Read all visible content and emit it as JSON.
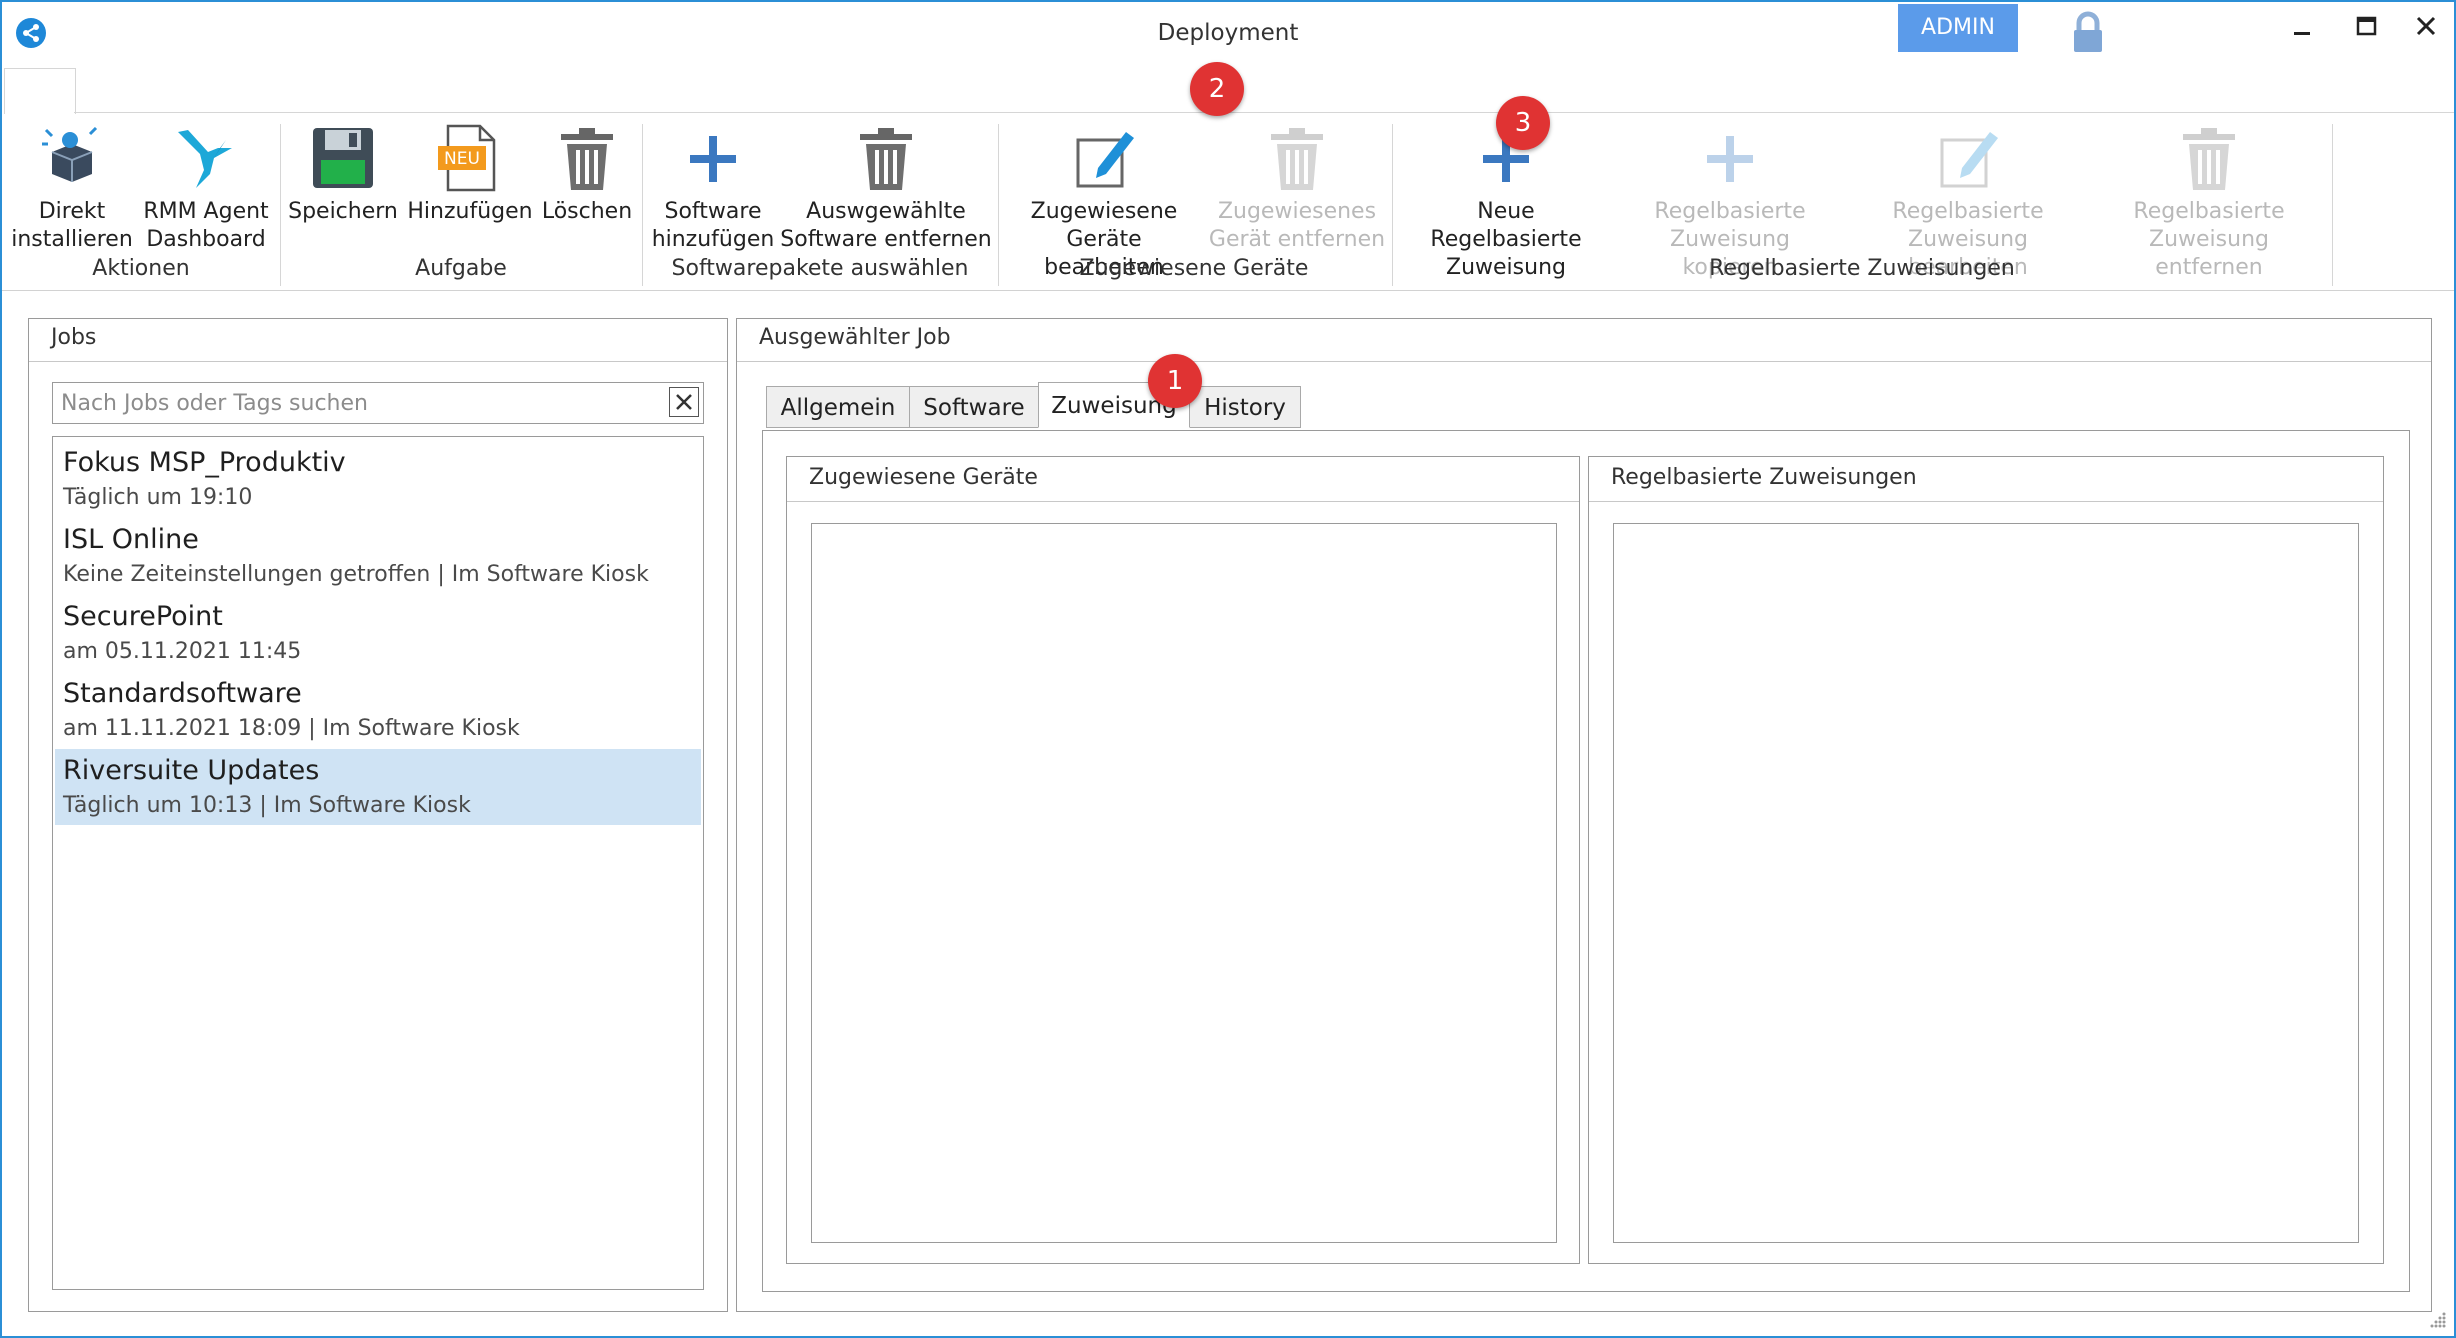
{
  "window": {
    "title": "Deployment",
    "user_badge": "ADMIN",
    "accent": "#2b8fd6",
    "badge_color": "#5b9bea"
  },
  "icons": [
    "share-icon",
    "lock-icon",
    "minimize-icon",
    "maximize-icon",
    "close-icon"
  ],
  "ribbon": {
    "groups": [
      {
        "label": "Aktionen",
        "buttons": [
          {
            "label": "Direkt installieren",
            "lines": [
              "Direkt",
              "installieren"
            ],
            "icon": "install-box-icon",
            "enabled": true
          },
          {
            "label": "RMM Agent Dashboard",
            "lines": [
              "RMM Agent",
              "Dashboard"
            ],
            "icon": "hummingbird-icon",
            "enabled": true
          }
        ]
      },
      {
        "label": "Aufgabe",
        "buttons": [
          {
            "label": "Speichern",
            "lines": [
              "Speichern"
            ],
            "icon": "floppy-disk-icon",
            "enabled": true
          },
          {
            "label": "Hinzufügen",
            "lines": [
              "Hinzufügen"
            ],
            "icon": "new-document-icon",
            "icon_text": "NEU",
            "enabled": true
          },
          {
            "label": "Löschen",
            "lines": [
              "Löschen"
            ],
            "icon": "trash-icon",
            "enabled": true
          }
        ]
      },
      {
        "label": "Softwarepakete auswählen",
        "buttons": [
          {
            "label": "Software hinzufügen",
            "lines": [
              "Software",
              "hinzufügen"
            ],
            "icon": "plus-icon",
            "enabled": true
          },
          {
            "label": "Auswgewählte Software entfernen",
            "lines": [
              "Auswgewählte",
              "Software entfernen"
            ],
            "icon": "trash-icon",
            "enabled": true
          }
        ]
      },
      {
        "label": "Zugewiesene Geräte",
        "buttons": [
          {
            "label": "Zugewiesene Geräte bearbeiten",
            "lines": [
              "Zugewiesene",
              "Geräte bearbeiten"
            ],
            "icon": "edit-icon",
            "enabled": true
          },
          {
            "label": "Zugewiesenes Gerät entfernen",
            "lines": [
              "Zugewiesenes",
              "Gerät entfernen"
            ],
            "icon": "trash-icon",
            "enabled": false
          }
        ]
      },
      {
        "label": "Regelbasierte Zuweisungen",
        "buttons": [
          {
            "label": "Neue Regelbasierte Zuweisung",
            "lines": [
              "Neue Regelbasierte",
              "Zuweisung"
            ],
            "icon": "plus-icon",
            "enabled": true
          },
          {
            "label": "Regelbasierte Zuweisung kopieren",
            "lines": [
              "Regelbasierte",
              "Zuweisung kopieren"
            ],
            "icon": "plus-icon",
            "enabled": false
          },
          {
            "label": "Regelbasierte Zuweisung bearbeiten",
            "lines": [
              "Regelbasierte",
              "Zuweisung bearbeiten"
            ],
            "icon": "edit-icon",
            "enabled": false
          },
          {
            "label": "Regelbasierte Zuweisung entfernen",
            "lines": [
              "Regelbasierte",
              "Zuweisung entfernen"
            ],
            "icon": "trash-icon",
            "enabled": false
          }
        ]
      }
    ]
  },
  "markers": [
    "1",
    "2",
    "3"
  ],
  "jobs_panel": {
    "title": "Jobs",
    "search_placeholder": "Nach Jobs oder Tags suchen",
    "search_value": "",
    "items": [
      {
        "name": "Fokus MSP_Produktiv",
        "schedule": "Täglich um 19:10",
        "selected": false
      },
      {
        "name": "ISL Online",
        "schedule": "Keine Zeiteinstellungen getroffen | Im Software Kiosk",
        "selected": false
      },
      {
        "name": "SecurePoint",
        "schedule": "am  05.11.2021 11:45",
        "selected": false
      },
      {
        "name": "Standardsoftware",
        "schedule": "am  11.11.2021 18:09 | Im Software Kiosk",
        "selected": false
      },
      {
        "name": "Riversuite Updates",
        "schedule": "Täglich um 10:13 | Im Software Kiosk",
        "selected": true
      }
    ]
  },
  "job_panel": {
    "title": "Ausgewählter Job",
    "tabs": [
      {
        "label": "Allgemein",
        "active": false
      },
      {
        "label": "Software",
        "active": false
      },
      {
        "label": "Zuweisung",
        "active": true
      },
      {
        "label": "History",
        "active": false
      }
    ],
    "assigned_devices": {
      "title": "Zugewiesene Geräte"
    },
    "rule_assignments": {
      "title": "Regelbasierte Zuweisungen"
    }
  }
}
